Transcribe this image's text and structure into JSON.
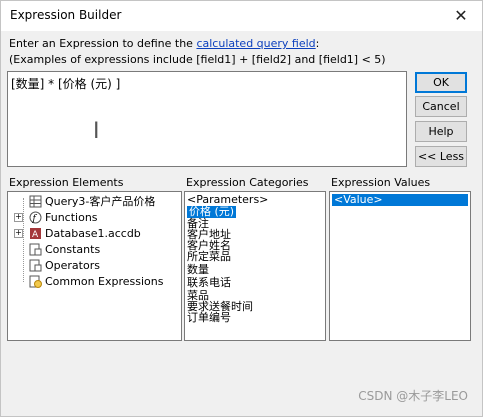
{
  "window": {
    "title": "Expression Builder",
    "close_symbol": "✕"
  },
  "intro": {
    "line1_prefix": "Enter an Expression to define the ",
    "line1_link": "calculated query field",
    "line1_suffix": ":",
    "line2": "(Examples of expressions include [field1] + [field2] and [field1] < 5)"
  },
  "expression": {
    "value": "[数量] * [价格 (元) ]"
  },
  "buttons": {
    "ok": "OK",
    "cancel": "Cancel",
    "help": "Help",
    "less": "<< Less"
  },
  "labels": {
    "elements": "Expression Elements",
    "categories": "Expression Categories",
    "values": "Expression Values"
  },
  "elements": [
    {
      "label": "Query3-客户产品价格",
      "icon": "query-icon",
      "expander": ""
    },
    {
      "label": "Functions",
      "icon": "functions-icon",
      "expander": "+"
    },
    {
      "label": "Database1.accdb",
      "icon": "database-icon",
      "expander": "+"
    },
    {
      "label": "Constants",
      "icon": "constants-icon",
      "expander": ""
    },
    {
      "label": "Operators",
      "icon": "operators-icon",
      "expander": ""
    },
    {
      "label": "Common Expressions",
      "icon": "common-expressions-icon",
      "expander": ""
    }
  ],
  "categories": [
    "<Parameters>",
    "价格 (元)",
    "备注",
    "客户地址",
    "客户姓名",
    "所定菜品",
    "数量",
    "联系电话",
    "菜品",
    "要求送餐时间",
    "订单编号"
  ],
  "values": [
    "<Value>"
  ],
  "colors": {
    "selection": "#0078d7",
    "link": "#0b3fbd",
    "dialog_bg": "#f0f0f0"
  },
  "watermark": "CSDN @木子李LEO"
}
